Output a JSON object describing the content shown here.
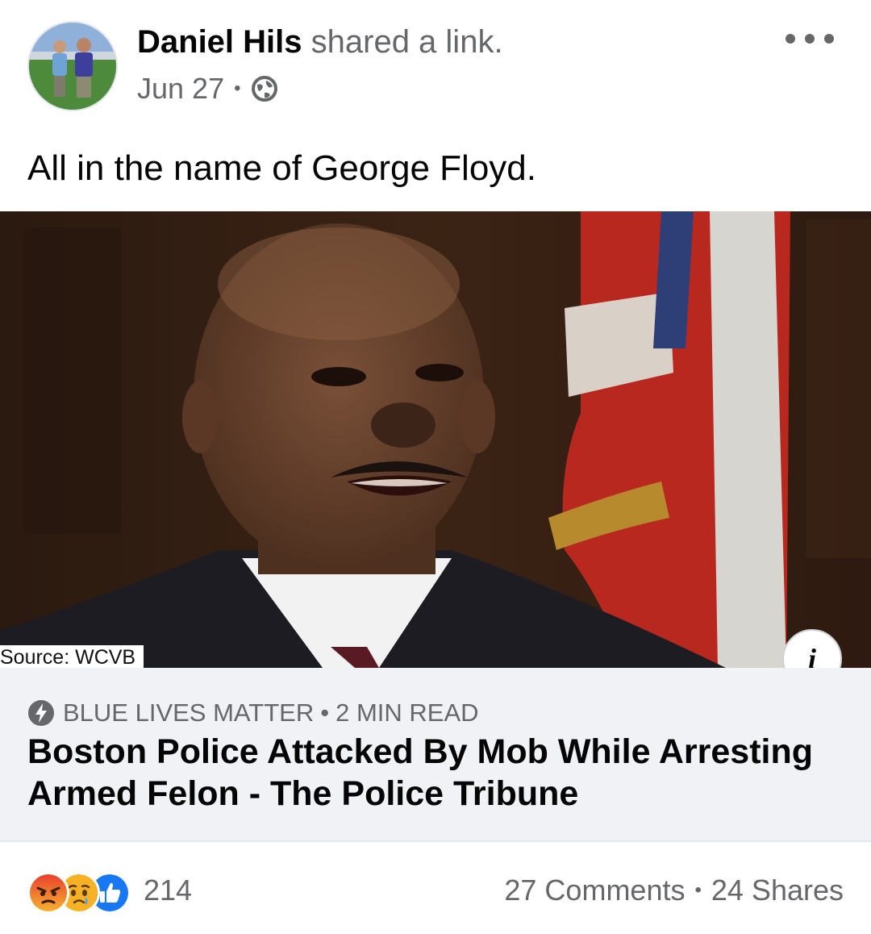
{
  "post": {
    "author_name": "Daniel Hils",
    "action_text": "shared a link.",
    "date": "Jun 27",
    "meta_separator": "•",
    "privacy_icon": "globe-icon",
    "more_icon": "more-options-icon",
    "caption": "All in the name of George Floyd."
  },
  "link_preview": {
    "image_source_label": "Source: WCVB",
    "info_icon_glyph": "i",
    "domain": "BLUE LIVES MATTER",
    "domain_separator": "•",
    "read_time": "2 MIN READ",
    "domain_icon": "lightning-bolt-icon",
    "title": "Boston Police Attacked By Mob While Arresting Armed Felon - The Police Tribune"
  },
  "footer": {
    "reactions": [
      "angry-reaction-icon",
      "sad-reaction-icon",
      "like-reaction-icon"
    ],
    "reaction_count": "214",
    "comments": "27 Comments",
    "stats_separator": "•",
    "shares": "24 Shares"
  },
  "colors": {
    "text_primary": "#050505",
    "text_secondary": "#65676b",
    "card_background": "#f0f2f5",
    "like_blue": "#1877f2",
    "reaction_yellow": "#f7b125"
  }
}
